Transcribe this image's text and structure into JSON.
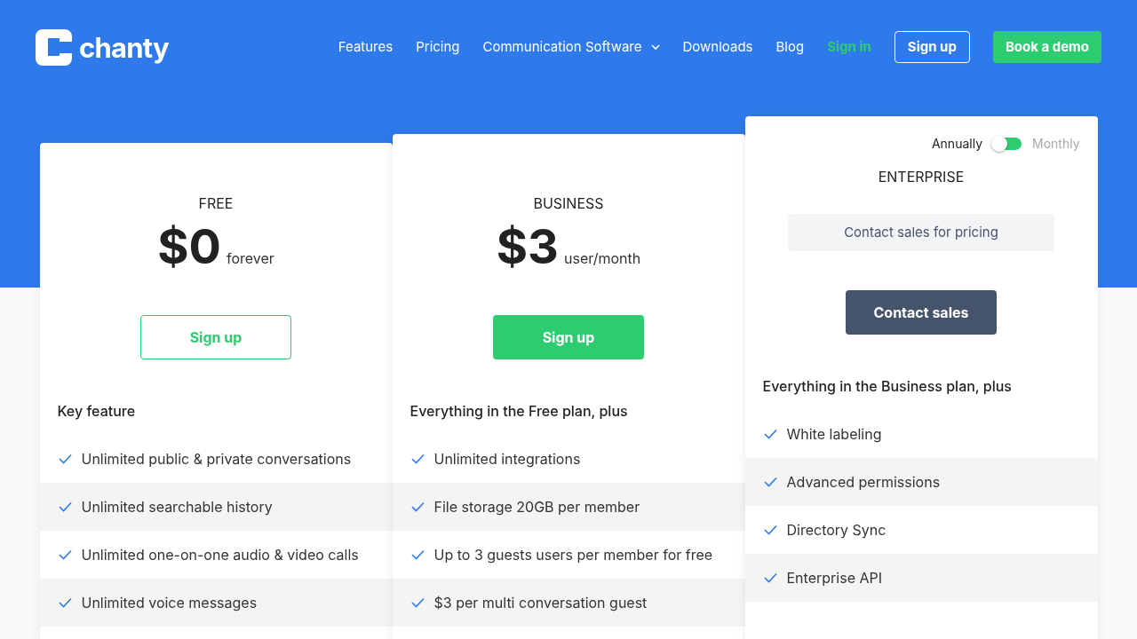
{
  "logo": {
    "text": "chanty"
  },
  "nav": [
    {
      "label": "Features",
      "kind": "link"
    },
    {
      "label": "Pricing",
      "kind": "link"
    },
    {
      "label": "Communication Software",
      "kind": "dropdown"
    },
    {
      "label": "Downloads",
      "kind": "link"
    },
    {
      "label": "Blog",
      "kind": "link"
    },
    {
      "label": "Sign in",
      "kind": "accent"
    },
    {
      "label": "Sign up",
      "kind": "outline"
    },
    {
      "label": "Book a demo",
      "kind": "solid"
    }
  ],
  "billing": [
    {
      "label": "Annually",
      "selected": true
    },
    {
      "label": "Monthly",
      "selected": false
    }
  ],
  "plans": [
    {
      "name": "FREE",
      "price": "$0",
      "period": "forever",
      "cta": {
        "label": "Sign up",
        "kind": "outline"
      },
      "intro": "Key feature",
      "features": [
        "Unlimited public & private conversations",
        "Unlimited searchable history",
        "Unlimited one-on-one audio & video calls",
        "Unlimited voice messages"
      ]
    },
    {
      "name": "BUSINESS",
      "price": "$3",
      "period": "user/month",
      "cta": {
        "label": "Sign up",
        "kind": "solid"
      },
      "intro": "Everything in the Free plan, plus",
      "features": [
        "Unlimited integrations",
        "File storage 20GB per member",
        "Up to 3 guests users per member for free",
        "$3 per multi conversation guest"
      ]
    },
    {
      "name": "ENTERPRISE",
      "note": "Contact sales for pricing",
      "cta": {
        "label": "Contact sales",
        "kind": "dark"
      },
      "intro": "Everything in the Business plan, plus",
      "features": [
        "White labeling",
        "Advanced permissions",
        "Directory Sync",
        "Enterprise API"
      ]
    }
  ]
}
